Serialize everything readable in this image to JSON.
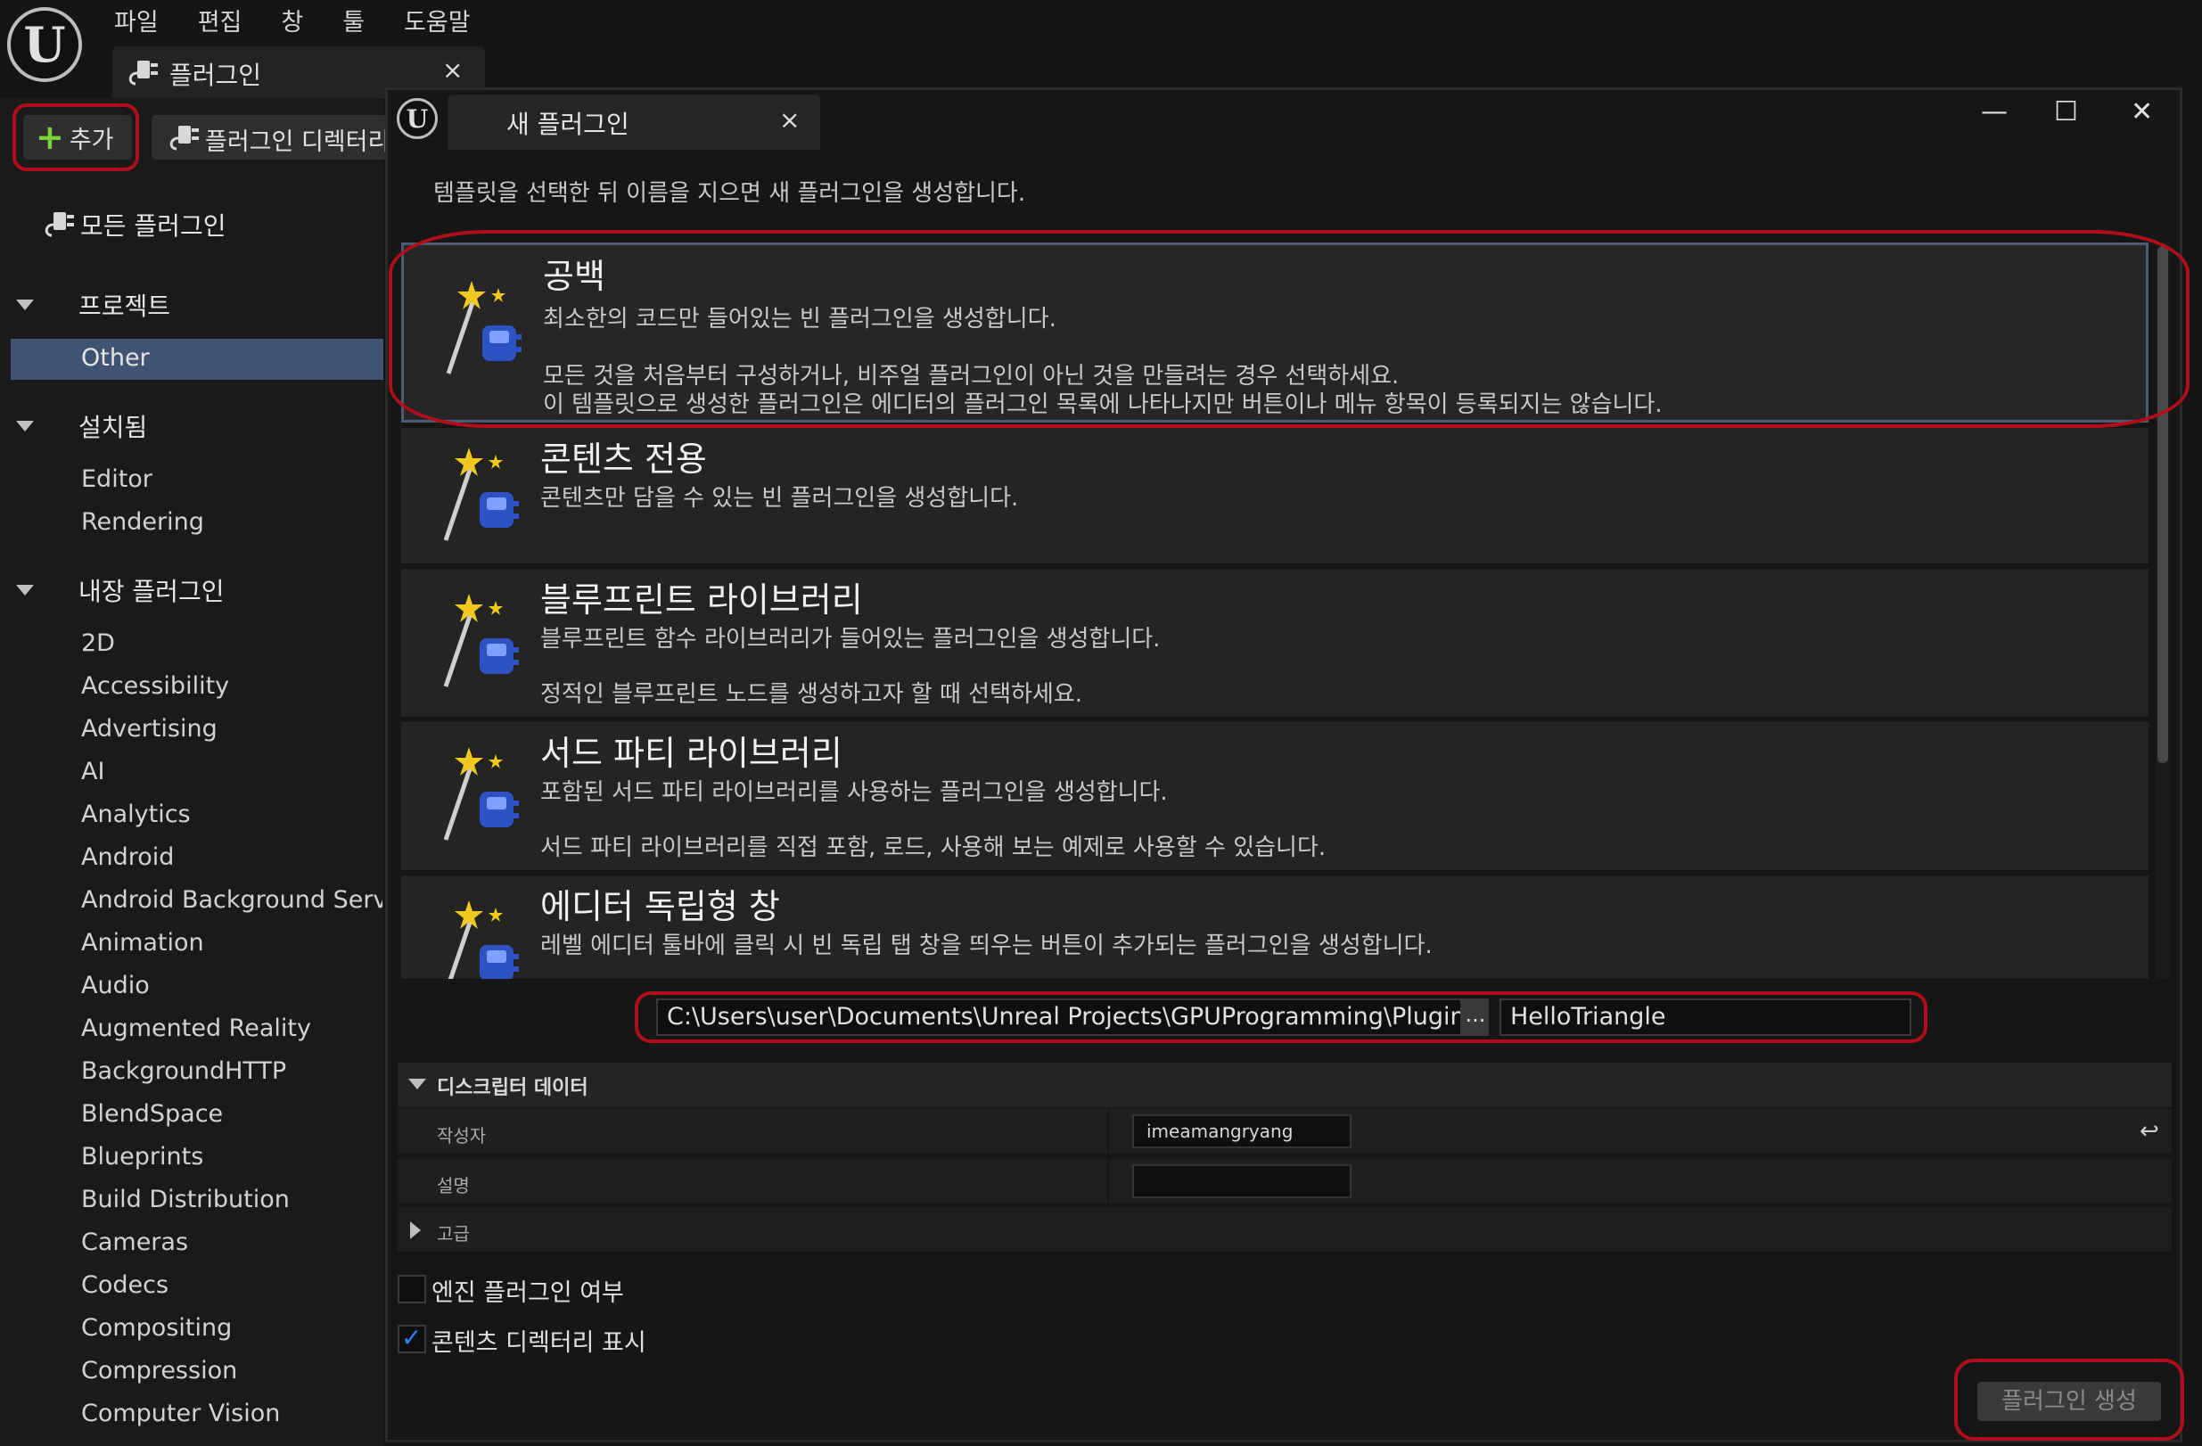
{
  "app": {
    "logo_glyph": "U",
    "menu": [
      "파일",
      "편집",
      "창",
      "툴",
      "도움말"
    ],
    "tab_title": "플러그인",
    "tab_close": "×"
  },
  "toolbar": {
    "add_label": "추가",
    "add_icon": "+",
    "dir_label": "플러그인 디렉터리"
  },
  "sidebar": {
    "all_plugins": "모든 플러그인",
    "sections": [
      {
        "label": "프로젝트",
        "items": [
          "Other"
        ]
      },
      {
        "label": "설치됨",
        "items": [
          "Editor",
          "Rendering"
        ]
      },
      {
        "label": "내장 플러그인",
        "items": [
          "2D",
          "Accessibility",
          "Advertising",
          "AI",
          "Analytics",
          "Android",
          "Android Background Service",
          "Animation",
          "Audio",
          "Augmented Reality",
          "BackgroundHTTP",
          "BlendSpace",
          "Blueprints",
          "Build Distribution",
          "Cameras",
          "Codecs",
          "Compositing",
          "Compression",
          "Computer Vision"
        ]
      }
    ],
    "selected_item": "Other"
  },
  "dialog": {
    "logo_glyph": "U",
    "title": "새 플러그인",
    "close": "×",
    "window_controls": {
      "minimize": "—",
      "maximize": "☐",
      "close": "✕"
    },
    "instruction": "템플릿을 선택한 뒤 이름을 지으면 새 플러그인을 생성합니다.",
    "templates": [
      {
        "name": "공백",
        "desc1": "최소한의 코드만 들어있는 빈 플러그인을 생성합니다.",
        "desc2": "모든 것을 처음부터 구성하거나, 비주얼 플러그인이 아닌 것을 만들려는 경우 선택하세요.",
        "desc3": "이 템플릿으로 생성한 플러그인은 에디터의 플러그인 목록에 나타나지만 버튼이나 메뉴 항목이 등록되지는 않습니다.",
        "selected": true
      },
      {
        "name": "콘텐츠 전용",
        "desc1": "콘텐츠만 담을 수 있는 빈 플러그인을 생성합니다.",
        "desc2": "",
        "desc3": "",
        "selected": false
      },
      {
        "name": "블루프린트 라이브러리",
        "desc1": "블루프린트 함수 라이브러리가 들어있는 플러그인을 생성합니다.",
        "desc2": "정적인 블루프린트 노드를 생성하고자 할 때 선택하세요.",
        "desc3": "",
        "selected": false
      },
      {
        "name": "서드 파티 라이브러리",
        "desc1": "포함된 서드 파티 라이브러리를 사용하는 플러그인을 생성합니다.",
        "desc2": "서드 파티 라이브러리를 직접 포함, 로드, 사용해 보는 예제로 사용할 수 있습니다.",
        "desc3": "",
        "selected": false
      },
      {
        "name": "에디터 독립형 창",
        "desc1": "레벨 에디터 툴바에 클릭 시 빈 독립 탭 창을 띄우는 버튼이 추가되는 플러그인을 생성합니다.",
        "desc2": "",
        "desc3": "",
        "selected": false
      }
    ],
    "path_value": "C:\\Users\\user\\Documents\\Unreal Projects\\GPUProgramming\\Plugins\\",
    "browse_label": "...",
    "plugin_name": "HelloTriangle",
    "descriptor": {
      "header": "디스크립터 데이터",
      "author_label": "작성자",
      "author_value": "imeamangryang",
      "description_label": "설명",
      "description_value": "",
      "advanced_label": "고급",
      "reset_icon": "↩"
    },
    "engine_plugin_label": "엔진 플러그인 여부",
    "engine_plugin_checked": false,
    "show_content_dir_label": "콘텐츠 디렉터리 표시",
    "show_content_dir_checked": true,
    "create_button": "플러그인 생성"
  },
  "colors": {
    "accent_selection": "#3f5472",
    "annotation_red": "#b00f1a",
    "checkbox_blue": "#2f7fff",
    "add_plus_green": "#7ad13a"
  }
}
